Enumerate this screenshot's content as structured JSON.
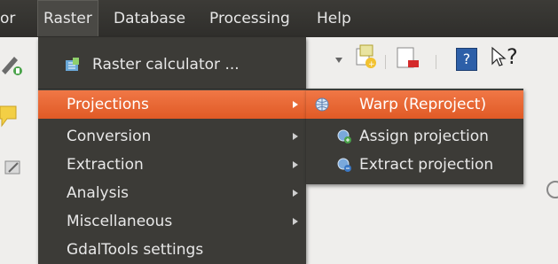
{
  "menubar": {
    "items": [
      {
        "label": "or"
      },
      {
        "label": "Raster"
      },
      {
        "label": "Database"
      },
      {
        "label": "Processing"
      },
      {
        "label": "Help"
      }
    ]
  },
  "raster_menu": {
    "calculator_label": "Raster calculator ...",
    "items": [
      {
        "label": "Projections"
      },
      {
        "label": "Conversion"
      },
      {
        "label": "Extraction"
      },
      {
        "label": "Analysis"
      },
      {
        "label": "Miscellaneous"
      },
      {
        "label": "GdalTools settings"
      }
    ]
  },
  "projections_submenu": {
    "items": [
      {
        "label": "Warp (Reproject)"
      },
      {
        "label": "Assign projection"
      },
      {
        "label": "Extract projection"
      }
    ]
  },
  "toolbar": {
    "help_icon_text": "?",
    "whats_this_text": "?"
  },
  "colors": {
    "highlight": "#e9652d",
    "menubar_bg": "#3c3b37",
    "menu_bg": "#3c3b37"
  }
}
